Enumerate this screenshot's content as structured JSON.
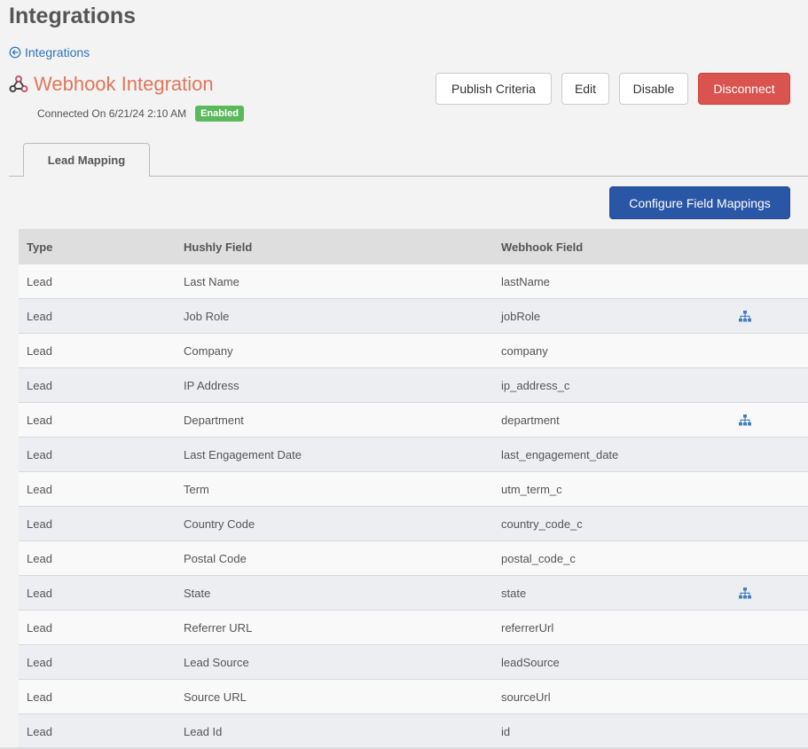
{
  "page": {
    "title": "Integrations"
  },
  "back_link": {
    "label": "Integrations",
    "icon": "arrow-left-circle-icon"
  },
  "integration": {
    "name": "Webhook Integration",
    "icon": "webhook-icon",
    "connected_text": "Connected On 6/21/24 2:10 AM",
    "status": "Enabled",
    "name_color": "#e0765c",
    "status_color": "#5cb85c"
  },
  "actions": {
    "publish_criteria": "Publish Criteria",
    "edit": "Edit",
    "disable": "Disable",
    "disconnect": "Disconnect",
    "disconnect_color": "#d9534f"
  },
  "tabs": [
    {
      "label": "Lead Mapping",
      "active": true
    }
  ],
  "configure_button": {
    "label": "Configure Field Mappings",
    "color": "#2a56a6"
  },
  "table": {
    "headers": [
      "Type",
      "Hushly Field",
      "Webhook Field"
    ],
    "rows": [
      {
        "type": "Lead",
        "hushly": "Last Name",
        "webhook": "lastName",
        "mapping": false
      },
      {
        "type": "Lead",
        "hushly": "Job Role",
        "webhook": "jobRole",
        "mapping": true
      },
      {
        "type": "Lead",
        "hushly": "Company",
        "webhook": "company",
        "mapping": false
      },
      {
        "type": "Lead",
        "hushly": "IP Address",
        "webhook": "ip_address_c",
        "mapping": false
      },
      {
        "type": "Lead",
        "hushly": "Department",
        "webhook": "department",
        "mapping": true
      },
      {
        "type": "Lead",
        "hushly": "Last Engagement Date",
        "webhook": "last_engagement_date",
        "mapping": false
      },
      {
        "type": "Lead",
        "hushly": "Term",
        "webhook": "utm_term_c",
        "mapping": false
      },
      {
        "type": "Lead",
        "hushly": "Country Code",
        "webhook": "country_code_c",
        "mapping": false
      },
      {
        "type": "Lead",
        "hushly": "Postal Code",
        "webhook": "postal_code_c",
        "mapping": false
      },
      {
        "type": "Lead",
        "hushly": "State",
        "webhook": "state",
        "mapping": true
      },
      {
        "type": "Lead",
        "hushly": "Referrer URL",
        "webhook": "referrerUrl",
        "mapping": false
      },
      {
        "type": "Lead",
        "hushly": "Lead Source",
        "webhook": "leadSource",
        "mapping": false
      },
      {
        "type": "Lead",
        "hushly": "Source URL",
        "webhook": "sourceUrl",
        "mapping": false
      },
      {
        "type": "Lead",
        "hushly": "Lead Id",
        "webhook": "id",
        "mapping": false
      }
    ],
    "mapping_icon": "sitemap-icon"
  }
}
